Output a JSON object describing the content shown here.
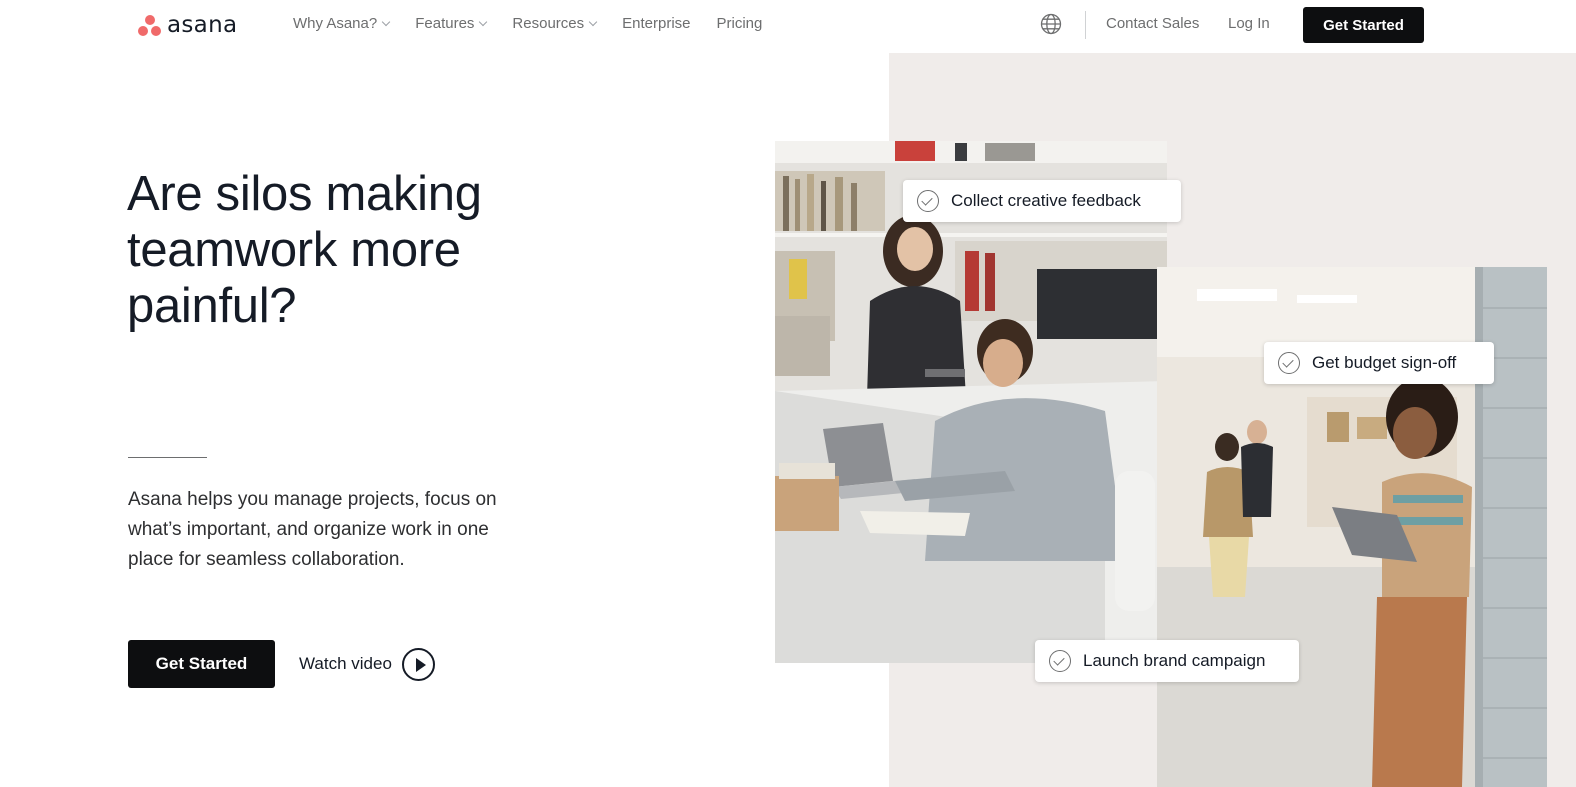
{
  "nav": {
    "logo_text": "asana",
    "links": [
      {
        "label": "Why Asana?",
        "dropdown": true
      },
      {
        "label": "Features",
        "dropdown": true
      },
      {
        "label": "Resources",
        "dropdown": true
      },
      {
        "label": "Enterprise",
        "dropdown": false
      },
      {
        "label": "Pricing",
        "dropdown": false
      }
    ],
    "contact_label": "Contact Sales",
    "login_label": "Log In",
    "cta_label": "Get Started"
  },
  "hero": {
    "headline": "Are silos making teamwork more painful?",
    "subtext": "Asana helps you manage projects, focus on what’s important, and organize work in one place for seamless collaboration.",
    "cta_label": "Get Started",
    "watch_label": "Watch video"
  },
  "tasks": [
    "Collect creative feedback",
    "Get budget sign-off",
    "Launch brand campaign"
  ],
  "colors": {
    "brand_coral": "#f06a6a",
    "button_dark": "#0d0e10",
    "panel_bg": "#f0ecea",
    "nav_text": "#6d6e6f"
  },
  "icons": {
    "globe": "globe-icon",
    "play": "play-icon",
    "check": "check-circle-icon",
    "chevron": "chevron-down-icon"
  }
}
